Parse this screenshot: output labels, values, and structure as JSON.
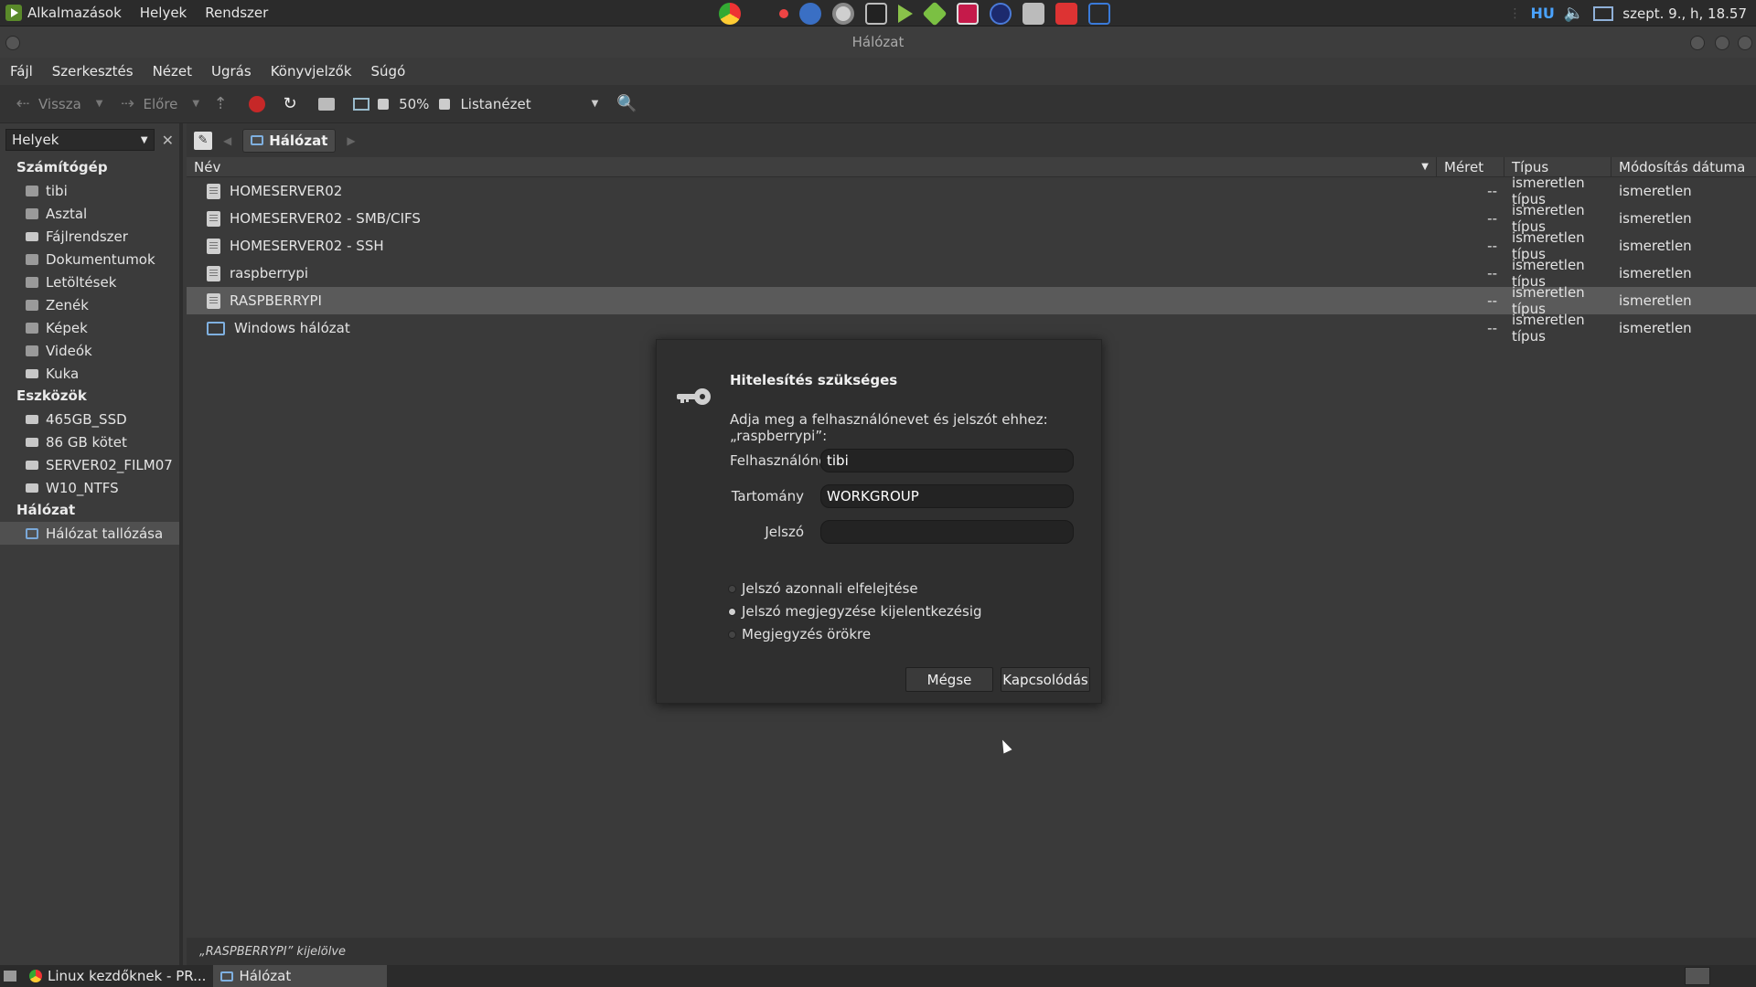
{
  "top_panel": {
    "menu": [
      "Alkalmazások",
      "Helyek",
      "Rendszer"
    ],
    "lang": "HU",
    "clock": "szept. 9., h, 18.57",
    "icons": [
      "chrome-icon",
      "record-icon",
      "sysinfo-icon",
      "gear-icon",
      "terminal-icon",
      "play-icon",
      "package-icon",
      "raspberry-icon",
      "circle-app-icon",
      "storage-icon",
      "dc-icon",
      "network-tray-icon"
    ]
  },
  "window": {
    "title": "Hálózat"
  },
  "menubar": [
    "Fájl",
    "Szerkesztés",
    "Nézet",
    "Ugrás",
    "Könyvjelzők",
    "Súgó"
  ],
  "toolbar": {
    "back": "Vissza",
    "forward": "Előre",
    "zoom": "50%",
    "view": "Listanézet"
  },
  "sidebar": {
    "selector": "Helyek",
    "sections": [
      {
        "title": "Számítógép",
        "items": [
          "tibi",
          "Asztal",
          "Fájlrendszer",
          "Dokumentumok",
          "Letöltések",
          "Zenék",
          "Képek",
          "Videók",
          "Kuka"
        ]
      },
      {
        "title": "Eszközök",
        "items": [
          "465GB_SSD",
          "86 GB kötet",
          "SERVER02_FILM07",
          "W10_NTFS"
        ]
      },
      {
        "title": "Hálózat",
        "items": [
          "Hálózat tallózása"
        ]
      }
    ]
  },
  "pathbar": {
    "crumb": "Hálózat"
  },
  "columns": {
    "name": "Név",
    "size": "Méret",
    "type": "Típus",
    "date": "Módosítás dátuma"
  },
  "rows": [
    {
      "name": "HOMESERVER02",
      "size": "--",
      "type": "ismeretlen típus",
      "date": "ismeretlen"
    },
    {
      "name": "HOMESERVER02 - SMB/CIFS",
      "size": "--",
      "type": "ismeretlen típus",
      "date": "ismeretlen"
    },
    {
      "name": "HOMESERVER02 - SSH",
      "size": "--",
      "type": "ismeretlen típus",
      "date": "ismeretlen"
    },
    {
      "name": "raspberrypi",
      "size": "--",
      "type": "ismeretlen típus",
      "date": "ismeretlen"
    },
    {
      "name": "RASPBERRYPI",
      "size": "--",
      "type": "ismeretlen típus",
      "date": "ismeretlen"
    },
    {
      "name": "Windows hálózat",
      "size": "--",
      "type": "ismeretlen típus",
      "date": "ismeretlen"
    }
  ],
  "status": "„RASPBERRYPI” kijelölve",
  "taskbar": {
    "tasks": [
      "Linux kezdőknek - PR...",
      "Hálózat"
    ]
  },
  "dialog": {
    "title": "Hitelesítés szükséges",
    "message": "Adja meg a felhasználónevet és jelszót ehhez: „raspberrypi”:",
    "username_label": "Felhasználónév",
    "username_value": "tibi",
    "domain_label": "Tartomány",
    "domain_value": "WORKGROUP",
    "password_label": "Jelszó",
    "password_value": "",
    "options": [
      "Jelszó azonnali elfelejtése",
      "Jelszó megjegyzése kijelentkezésig",
      "Megjegyzés örökre"
    ],
    "selected_option": "Jelszó megjegyzése kijelentkezésig",
    "cancel": "Mégse",
    "connect": "Kapcsolódás"
  }
}
